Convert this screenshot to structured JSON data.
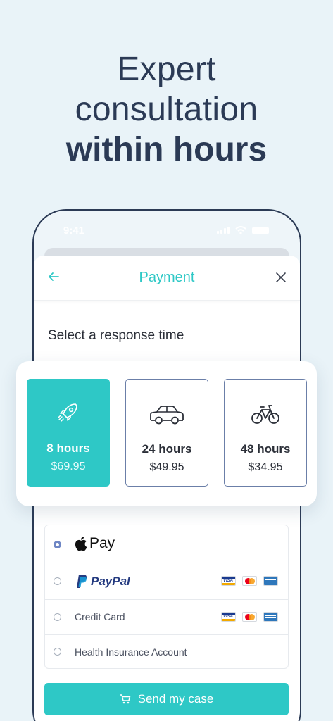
{
  "headline": {
    "line1": "Expert",
    "line2": "consultation",
    "line3": "within hours"
  },
  "status_bar": {
    "time": "9:41"
  },
  "nav": {
    "title": "Payment"
  },
  "subtitle": "Select a response time",
  "response_options": [
    {
      "hours": "8 hours",
      "price": "$69.95",
      "icon": "rocket-icon",
      "selected": true
    },
    {
      "hours": "24 hours",
      "price": "$49.95",
      "icon": "car-icon",
      "selected": false
    },
    {
      "hours": "48 hours",
      "price": "$34.95",
      "icon": "bicycle-icon",
      "selected": false
    }
  ],
  "payment_methods": [
    {
      "label": "Pay",
      "brand": "Apple Pay",
      "selected": true
    },
    {
      "label": "PayPal",
      "brand": "PayPal",
      "selected": false
    },
    {
      "label": "Credit Card",
      "selected": false
    },
    {
      "label": "Health Insurance Account",
      "selected": false
    }
  ],
  "send_button": {
    "label": "Send my case"
  },
  "colors": {
    "accent": "#2ec8c6",
    "text_dark": "#2b3a55",
    "background": "#e9f3f8",
    "radio_selected": "#6e86c4"
  }
}
